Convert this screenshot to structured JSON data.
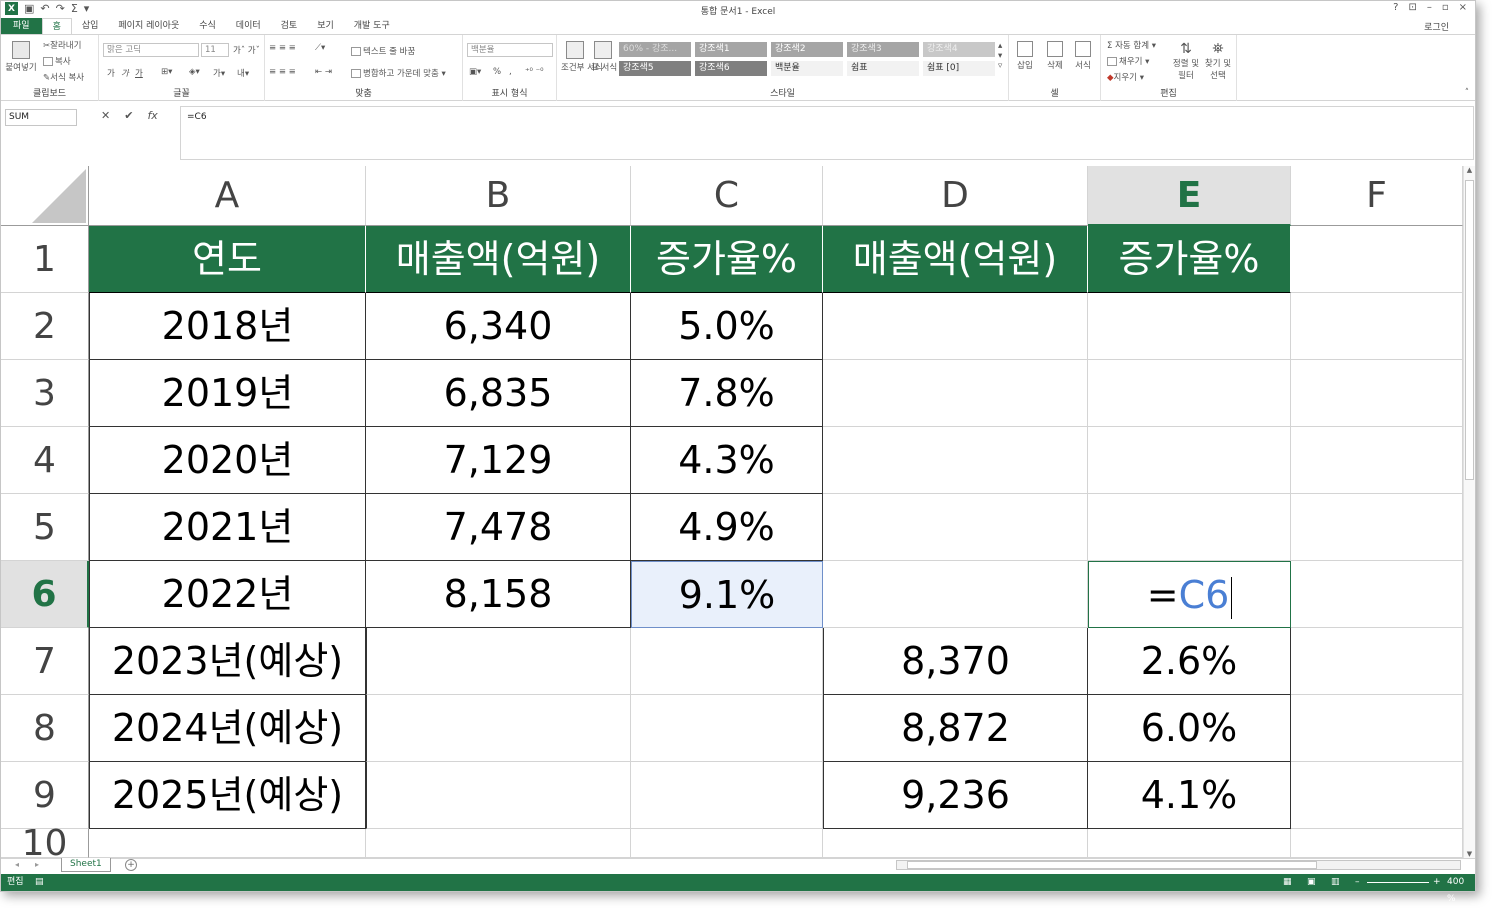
{
  "window": {
    "title": "통합 문서1 - Excel",
    "login": "로그인",
    "help": "?",
    "minimize": "–",
    "restore": "▫",
    "close": "×"
  },
  "qat": {
    "save_icon": "save-icon",
    "undo": "↶",
    "redo": "↷",
    "sum": "Σ",
    "more": "▾"
  },
  "tabs": [
    "파일",
    "홈",
    "삽입",
    "페이지 레이아웃",
    "수식",
    "데이터",
    "검토",
    "보기",
    "개발 도구"
  ],
  "ribbon": {
    "clipboard": {
      "label": "클립보드",
      "paste": "붙여넣기",
      "cut": "잘라내기",
      "copy": "복사",
      "format_painter": "서식 복사"
    },
    "font": {
      "label": "글꼴",
      "font_name": "맑은 고딕",
      "font_size": "11",
      "bold": "가",
      "italic": "가",
      "underline": "가"
    },
    "align": {
      "label": "맞춤",
      "wrap": "텍스트 줄 바꿈",
      "merge": "병합하고 가운데 맞춤"
    },
    "number": {
      "label": "표시 형식",
      "format": "백분율",
      "percent": "%",
      "comma": ","
    },
    "styles": {
      "label": "스타일",
      "cond_format": "조건부 서식",
      "table_format": "표 서식",
      "cells": [
        "60% - 강조...",
        "강조색1",
        "강조색2",
        "강조색3",
        "강조색4",
        "강조색5",
        "강조색6",
        "백분율",
        "쉼표",
        "쉼표 [0]"
      ]
    },
    "cells": {
      "label": "셀",
      "insert": "삽입",
      "delete": "삭제",
      "format": "서식"
    },
    "editing": {
      "label": "편집",
      "autosum": "자동 합계",
      "fill": "채우기",
      "clear": "지우기",
      "sort": "정렬 및 필터",
      "find": "찾기 및 선택"
    }
  },
  "formula_bar": {
    "name_box": "SUM",
    "cancel": "✕",
    "enter": "✔",
    "fx": "fx",
    "formula": "=C6"
  },
  "columns": [
    "A",
    "B",
    "C",
    "D",
    "E",
    "F"
  ],
  "rows": [
    "1",
    "2",
    "3",
    "4",
    "5",
    "6",
    "7",
    "8",
    "9",
    "10"
  ],
  "table": {
    "headers": [
      "연도",
      "매출액(억원)",
      "증가율%",
      "매출액(억원)",
      "증가율%"
    ],
    "data": [
      [
        "2018년",
        "6,340",
        "5.0%",
        "",
        ""
      ],
      [
        "2019년",
        "6,835",
        "7.8%",
        "",
        ""
      ],
      [
        "2020년",
        "7,129",
        "4.3%",
        "",
        ""
      ],
      [
        "2021년",
        "7,478",
        "4.9%",
        "",
        ""
      ],
      [
        "2022년",
        "8,158",
        "9.1%",
        "",
        ""
      ],
      [
        "2023년(예상)",
        "",
        "",
        "8,370",
        "2.6%"
      ],
      [
        "2024년(예상)",
        "",
        "",
        "8,872",
        "6.0%"
      ],
      [
        "2025년(예상)",
        "",
        "",
        "9,236",
        "4.1%"
      ]
    ],
    "edit_cell": {
      "eq": "=",
      "ref": "C6"
    }
  },
  "sheet": {
    "tab": "Sheet1",
    "add": "+"
  },
  "status": {
    "mode": "편집",
    "zoom": "400 %"
  }
}
